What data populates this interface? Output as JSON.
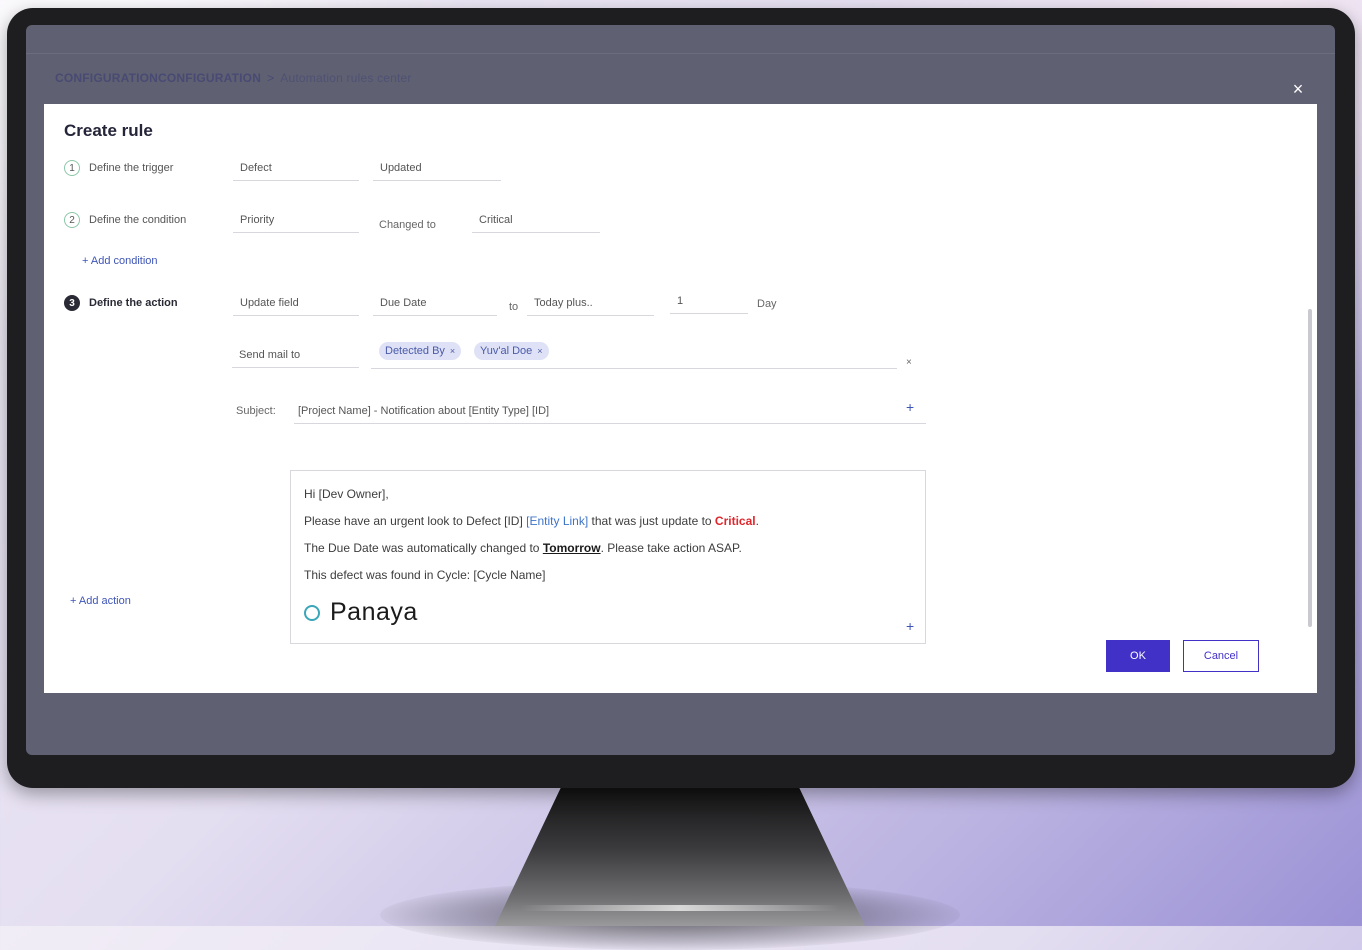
{
  "breadcrumb": {
    "root": "CONFIGURATIONCONFIGURATION",
    "separator": ">",
    "current": "Automation rules center"
  },
  "close_icon": "×",
  "dialog": {
    "title": "Create rule",
    "steps": [
      {
        "number": "1",
        "label": "Define the trigger",
        "fields": [
          "Defect",
          "Updated"
        ]
      },
      {
        "number": "2",
        "label": "Define the condition",
        "fields": [
          "Priority",
          "Critical"
        ],
        "operator": "Changed to"
      },
      {
        "number": "3",
        "label": "Define the action",
        "fields": [
          "Update field",
          "Due Date",
          "Today plus..",
          "1"
        ],
        "connector": "to",
        "unit": "Day"
      }
    ],
    "add_condition": "+ Add condition",
    "add_action": "+ Add action",
    "send_mail_label": "Send mail to",
    "recipients": [
      "Detected By",
      "Yuv'al Doe"
    ],
    "chip_remove_icon": "×",
    "clear_icon": "×",
    "subject_label": "Subject:",
    "subject_value": "[Project Name] - Notification about [Entity Type] [ID]",
    "plus_icon": "+",
    "body": {
      "greeting": "Hi [Dev Owner],",
      "line2_a": "Please have an urgent look to Defect [ID] ",
      "line2_link": "[Entity Link]",
      "line2_b": " that was just update to ",
      "line2_crit": "Critical",
      "line2_c": ".",
      "line3_a": "The Due Date was automatically changed to ",
      "line3_bold": "Tomorrow",
      "line3_b": ". Please take action ASAP.",
      "line4": "This defect was found in Cycle: [Cycle Name]",
      "logo": "Panaya"
    },
    "ok_label": "OK",
    "cancel_label": "Cancel"
  },
  "colors": {
    "primary": "#4231c7",
    "critical": "#e0252b",
    "link": "#3e55b8",
    "screen_bg": "#5f6071"
  }
}
